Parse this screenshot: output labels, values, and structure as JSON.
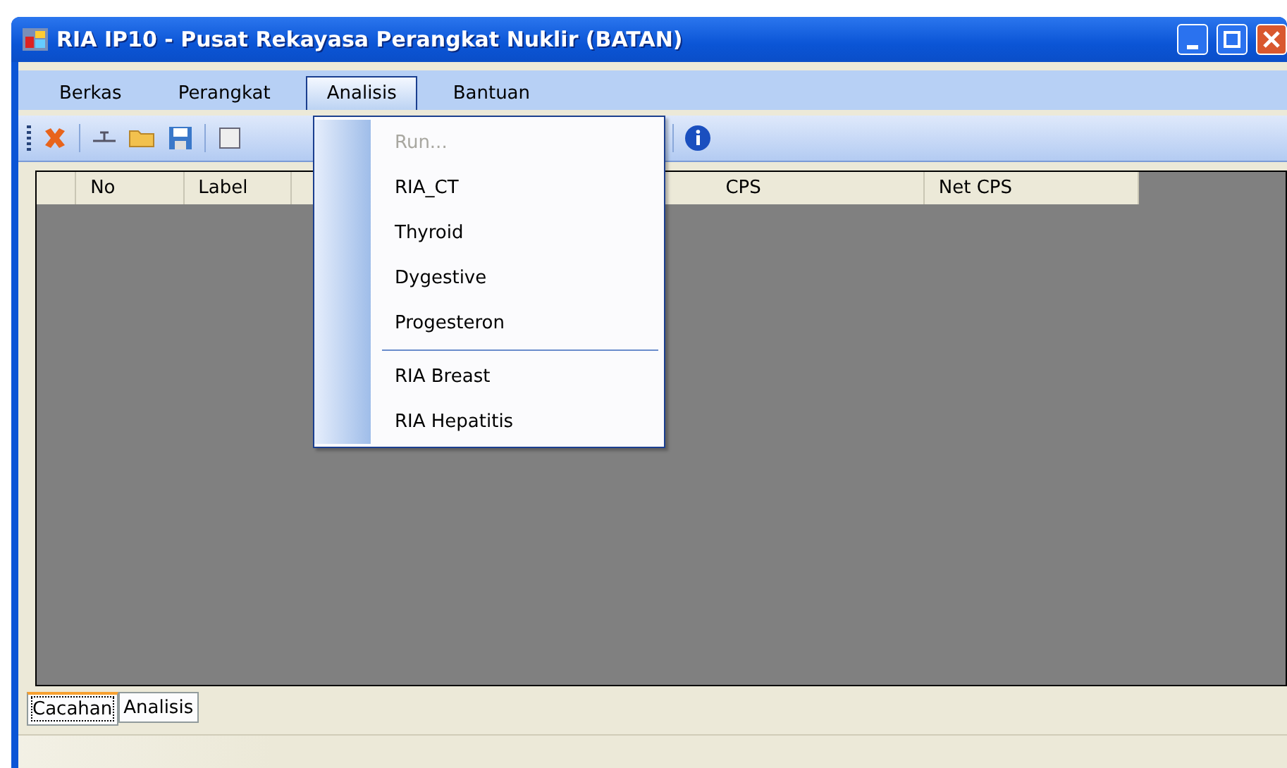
{
  "window": {
    "title": "RIA IP10 - Pusat Rekayasa Perangkat Nuklir (BATAN)"
  },
  "menu_bar": [
    {
      "label": "Berkas",
      "selected": false
    },
    {
      "label": "Perangkat",
      "selected": false
    },
    {
      "label": "Analisis",
      "selected": true
    },
    {
      "label": "Bantuan",
      "selected": false
    }
  ],
  "dropdown_menu": [
    {
      "kind": "item",
      "label": "Run...",
      "disabled": true
    },
    {
      "kind": "item",
      "label": "RIA_CT",
      "disabled": false
    },
    {
      "kind": "item",
      "label": "Thyroid",
      "disabled": false
    },
    {
      "kind": "item",
      "label": "Dygestive",
      "disabled": false
    },
    {
      "kind": "item",
      "label": "Progesteron",
      "disabled": false
    },
    {
      "kind": "separator"
    },
    {
      "kind": "item",
      "label": "RIA Breast",
      "disabled": false
    },
    {
      "kind": "item",
      "label": "RIA Hepatitis",
      "disabled": false
    }
  ],
  "table": {
    "columns": [
      "No",
      "Label",
      "CPS",
      "Net CPS"
    ]
  },
  "tabs": [
    {
      "label": "Cacahan",
      "selected": true
    },
    {
      "label": "Analisis",
      "selected": false
    }
  ]
}
